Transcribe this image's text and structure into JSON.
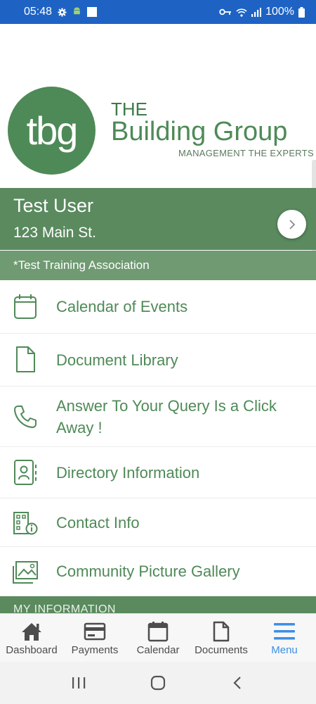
{
  "status_bar": {
    "time": "05:48",
    "battery": "100%",
    "icons": [
      "gear-icon",
      "android-icon",
      "square-icon",
      "vpn-key-icon",
      "wifi-icon",
      "signal-icon",
      "battery-icon"
    ]
  },
  "logo": {
    "mark": "tbg",
    "line1": "THE",
    "line2": "Building Group",
    "tagline": "MANAGEMENT THE EXPERTS",
    "color": "#4e8a57"
  },
  "user": {
    "name": "Test User",
    "address": "123 Main St.",
    "association": "*Test Training Association"
  },
  "menu": {
    "items": [
      {
        "label": "Calendar of Events",
        "icon": "calendar-icon"
      },
      {
        "label": "Document Library",
        "icon": "document-icon"
      },
      {
        "label": "Answer To Your Query Is a Click Away !",
        "icon": "phone-icon"
      },
      {
        "label": "Directory Information",
        "icon": "contact-card-icon"
      },
      {
        "label": "Contact Info",
        "icon": "building-info-icon"
      },
      {
        "label": "Community Picture Gallery",
        "icon": "gallery-icon"
      }
    ],
    "section_header": "MY INFORMATION"
  },
  "bottom_nav": {
    "items": [
      {
        "label": "Dashboard",
        "icon": "home-icon"
      },
      {
        "label": "Payments",
        "icon": "credit-card-icon"
      },
      {
        "label": "Calendar",
        "icon": "calendar-icon"
      },
      {
        "label": "Documents",
        "icon": "document-icon"
      },
      {
        "label": "Menu",
        "icon": "hamburger-menu-icon",
        "active": true
      }
    ],
    "active_color": "#3d8ee6"
  },
  "system_nav": [
    "recents-icon",
    "home-circle-icon",
    "back-icon"
  ],
  "colors": {
    "status_bar": "#1e63c4",
    "header_green": "#5a8a5e",
    "association_green": "#6f9a72",
    "text_green": "#4e8a57"
  }
}
